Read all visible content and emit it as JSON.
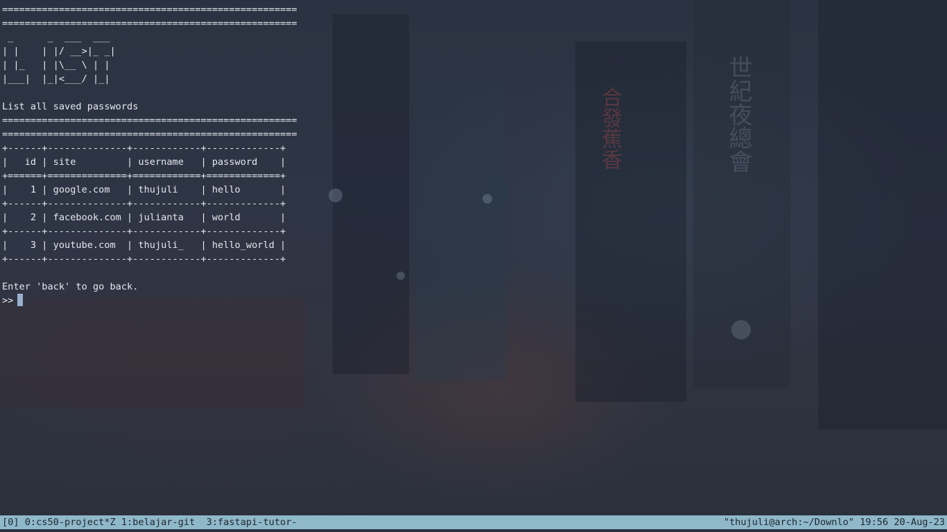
{
  "terminal": {
    "sep1": "====================================================",
    "sep2": "====================================================",
    "banner1": " _      _  ___  ___ ",
    "banner2": "| |    | |/ __>|_ _|",
    "banner3": "| |_   | |\\__ \\ | | ",
    "banner4": "|___|  |_|<___/ |_| ",
    "blank1": "",
    "subtitle": "List all saved passwords",
    "sep3": "====================================================",
    "sep4": "====================================================",
    "table": {
      "border": "+------+--------------+------------+-------------+",
      "header_border": "+======+==============+============+=============+",
      "header": "|   id | site         | username   | password    |",
      "rows": [
        "|    1 | google.com   | thujuli    | hello       |",
        "|    2 | facebook.com | julianta   | world       |",
        "|    3 | youtube.com  | thujuli_   | hello_world |"
      ]
    },
    "blank2": "",
    "instruction": "Enter 'back' to go back.",
    "prompt": ">>"
  },
  "statusbar": {
    "left": "[0] 0:cs50-project*Z 1:belajar-git  3:fastapi-tutor-",
    "right": "\"thujuli@arch:~/Downlo\" 19:56 20-Aug-23"
  },
  "colors": {
    "background": "#2a3140",
    "text": "#e6e8ee",
    "cursor": "#9ab0cc",
    "statusbar_bg": "#8fb8c9",
    "statusbar_fg": "#1e2630"
  },
  "icons": {
    "cursor": "block-cursor-icon"
  }
}
